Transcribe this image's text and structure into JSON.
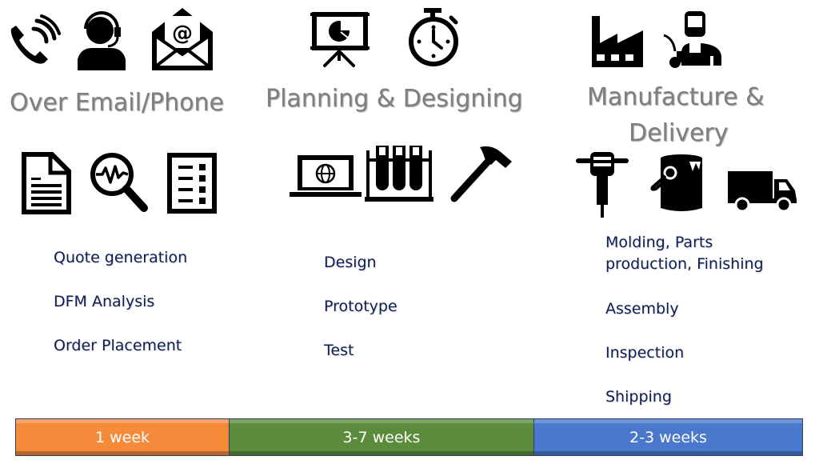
{
  "stages": [
    {
      "title": "Over Email/Phone",
      "top_icons": [
        "phone-icon",
        "support-agent-icon",
        "email-icon"
      ],
      "bottom_icons": [
        "document-icon",
        "analysis-magnifier-icon",
        "checklist-icon"
      ],
      "tasks": [
        "Quote generation",
        "DFM Analysis",
        "Order Placement"
      ]
    },
    {
      "title": "Planning & Designing",
      "top_icons": [
        "presentation-icon",
        "stopwatch-icon"
      ],
      "bottom_icons": [
        "laptop-icon",
        "test-tubes-icon",
        "hammer-icon"
      ],
      "tasks": [
        "Design",
        "Prototype",
        "Test"
      ]
    },
    {
      "title_line1": "Manufacture &",
      "title_line2": "Delivery",
      "top_icons": [
        "factory-icon",
        "welder-icon"
      ],
      "bottom_icons": [
        "jackhammer-icon",
        "paint-bucket-icon",
        "truck-icon"
      ],
      "tasks": [
        "Molding, Parts",
        "production, Finishing",
        "Assembly",
        "Inspection",
        "Shipping"
      ]
    }
  ],
  "timeline": [
    {
      "label": "1 week",
      "color": "#f58a3a"
    },
    {
      "label": "3-7 weeks",
      "color": "#5b8c3c"
    },
    {
      "label": "2-3 weeks",
      "color": "#4a78cc"
    }
  ],
  "colors": {
    "title_text": "#7f7f7f",
    "task_text": "#0d1d55",
    "icon": "#000000"
  }
}
